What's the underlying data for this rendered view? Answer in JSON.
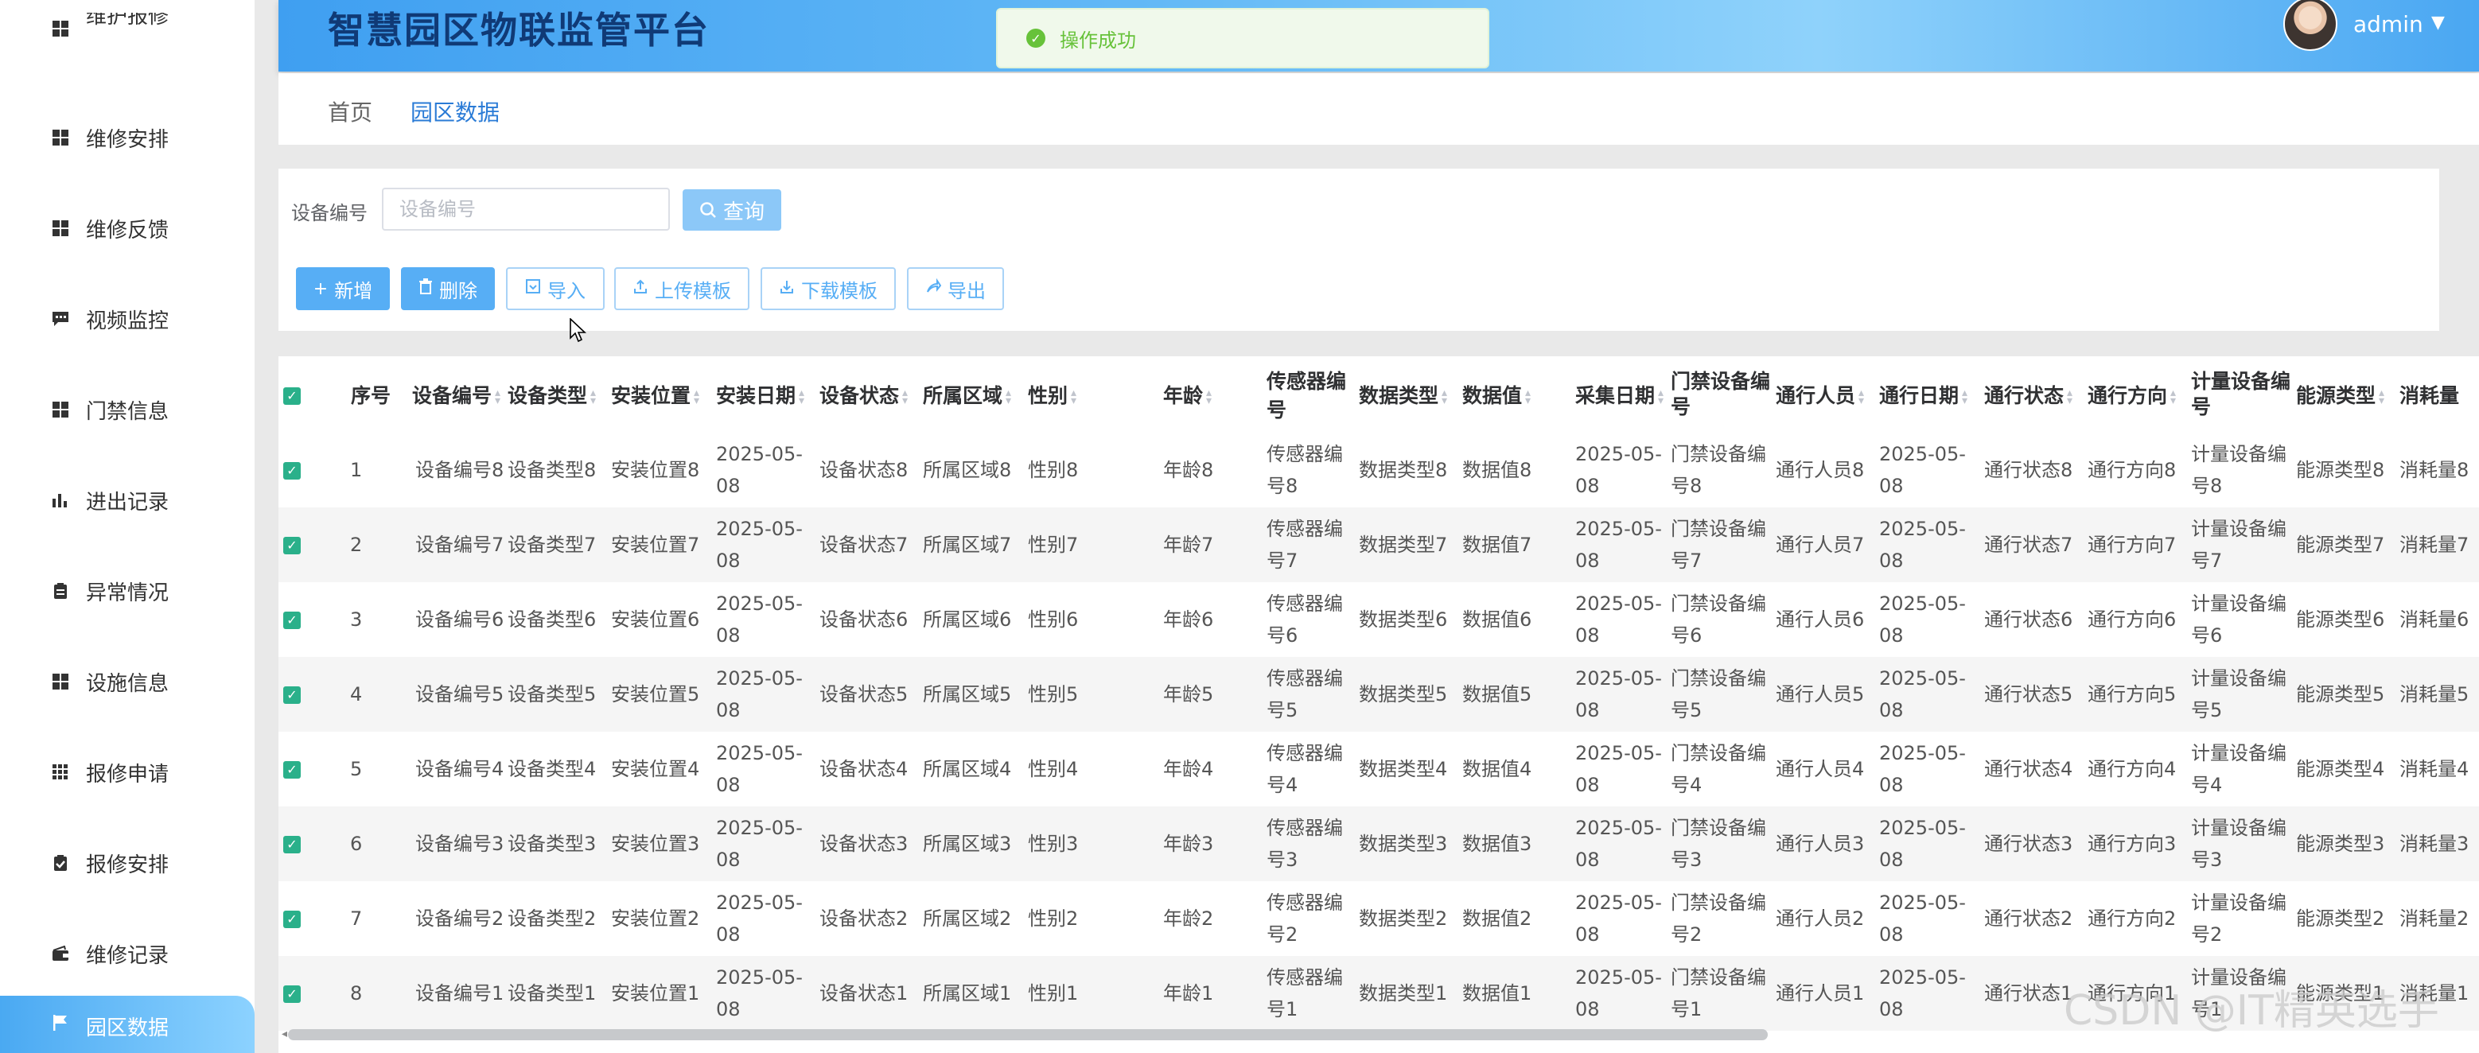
{
  "app": {
    "title": "智慧园区物联监管平台",
    "user": "admin"
  },
  "toast": {
    "message": "操作成功"
  },
  "sidebar": {
    "items": [
      {
        "label": "维护报修",
        "icon": "grid-icon"
      },
      {
        "label": "维修安排",
        "icon": "grid-icon"
      },
      {
        "label": "维修反馈",
        "icon": "grid-icon"
      },
      {
        "label": "视频监控",
        "icon": "chat-icon"
      },
      {
        "label": "门禁信息",
        "icon": "grid-icon"
      },
      {
        "label": "进出记录",
        "icon": "bar-chart-icon"
      },
      {
        "label": "异常情况",
        "icon": "clipboard-icon"
      },
      {
        "label": "设施信息",
        "icon": "grid-icon"
      },
      {
        "label": "报修申请",
        "icon": "apps-icon"
      },
      {
        "label": "报修安排",
        "icon": "clipboard-check-icon"
      },
      {
        "label": "维修记录",
        "icon": "wallet-icon"
      },
      {
        "label": "园区数据",
        "icon": "flag-icon",
        "active": true
      }
    ]
  },
  "breadcrumb": {
    "home": "首页",
    "current": "园区数据"
  },
  "search": {
    "label": "设备编号",
    "placeholder": "设备编号",
    "value": "",
    "query_label": "查询"
  },
  "toolbar": {
    "add": "新增",
    "delete": "删除",
    "import": "导入",
    "upload_template": "上传模板",
    "download_template": "下载模板",
    "export": "导出"
  },
  "table": {
    "columns": [
      "序号",
      "设备编号",
      "设备类型",
      "安装位置",
      "安装日期",
      "设备状态",
      "所属区域",
      "性别",
      "年龄",
      "传感器编号",
      "数据类型",
      "数据值",
      "采集日期",
      "门禁设备编号",
      "通行人员",
      "通行日期",
      "通行状态",
      "通行方向",
      "计量设备编号",
      "能源类型",
      "消耗量"
    ],
    "rows": [
      {
        "seq": "1",
        "c": [
          "设备编号8",
          "设备类型8",
          "安装位置8",
          "2025-05-08",
          "设备状态8",
          "所属区域8",
          "性别8",
          "年龄8",
          "传感器编号8",
          "数据类型8",
          "数据值8",
          "2025-05-08",
          "门禁设备编号8",
          "通行人员8",
          "2025-05-08",
          "通行状态8",
          "通行方向8",
          "计量设备编号8",
          "能源类型8",
          "消耗量8"
        ]
      },
      {
        "seq": "2",
        "c": [
          "设备编号7",
          "设备类型7",
          "安装位置7",
          "2025-05-08",
          "设备状态7",
          "所属区域7",
          "性别7",
          "年龄7",
          "传感器编号7",
          "数据类型7",
          "数据值7",
          "2025-05-08",
          "门禁设备编号7",
          "通行人员7",
          "2025-05-08",
          "通行状态7",
          "通行方向7",
          "计量设备编号7",
          "能源类型7",
          "消耗量7"
        ]
      },
      {
        "seq": "3",
        "c": [
          "设备编号6",
          "设备类型6",
          "安装位置6",
          "2025-05-08",
          "设备状态6",
          "所属区域6",
          "性别6",
          "年龄6",
          "传感器编号6",
          "数据类型6",
          "数据值6",
          "2025-05-08",
          "门禁设备编号6",
          "通行人员6",
          "2025-05-08",
          "通行状态6",
          "通行方向6",
          "计量设备编号6",
          "能源类型6",
          "消耗量6"
        ]
      },
      {
        "seq": "4",
        "c": [
          "设备编号5",
          "设备类型5",
          "安装位置5",
          "2025-05-08",
          "设备状态5",
          "所属区域5",
          "性别5",
          "年龄5",
          "传感器编号5",
          "数据类型5",
          "数据值5",
          "2025-05-08",
          "门禁设备编号5",
          "通行人员5",
          "2025-05-08",
          "通行状态5",
          "通行方向5",
          "计量设备编号5",
          "能源类型5",
          "消耗量5"
        ]
      },
      {
        "seq": "5",
        "c": [
          "设备编号4",
          "设备类型4",
          "安装位置4",
          "2025-05-08",
          "设备状态4",
          "所属区域4",
          "性别4",
          "年龄4",
          "传感器编号4",
          "数据类型4",
          "数据值4",
          "2025-05-08",
          "门禁设备编号4",
          "通行人员4",
          "2025-05-08",
          "通行状态4",
          "通行方向4",
          "计量设备编号4",
          "能源类型4",
          "消耗量4"
        ]
      },
      {
        "seq": "6",
        "c": [
          "设备编号3",
          "设备类型3",
          "安装位置3",
          "2025-05-08",
          "设备状态3",
          "所属区域3",
          "性别3",
          "年龄3",
          "传感器编号3",
          "数据类型3",
          "数据值3",
          "2025-05-08",
          "门禁设备编号3",
          "通行人员3",
          "2025-05-08",
          "通行状态3",
          "通行方向3",
          "计量设备编号3",
          "能源类型3",
          "消耗量3"
        ]
      },
      {
        "seq": "7",
        "c": [
          "设备编号2",
          "设备类型2",
          "安装位置2",
          "2025-05-08",
          "设备状态2",
          "所属区域2",
          "性别2",
          "年龄2",
          "传感器编号2",
          "数据类型2",
          "数据值2",
          "2025-05-08",
          "门禁设备编号2",
          "通行人员2",
          "2025-05-08",
          "通行状态2",
          "通行方向2",
          "计量设备编号2",
          "能源类型2",
          "消耗量2"
        ]
      },
      {
        "seq": "8",
        "c": [
          "设备编号1",
          "设备类型1",
          "安装位置1",
          "2025-05-08",
          "设备状态1",
          "所属区域1",
          "性别1",
          "年龄1",
          "传感器编号1",
          "数据类型1",
          "数据值1",
          "2025-05-08",
          "门禁设备编号1",
          "通行人员1",
          "2025-05-08",
          "通行状态1",
          "通行方向1",
          "计量设备编号1",
          "能源类型1",
          "消耗量1"
        ]
      }
    ]
  },
  "watermark": "CSDN @IT精英选手",
  "colors": {
    "primary": "#57aef5",
    "success": "#67c23a",
    "checkbox": "#2ab08a",
    "title": "#103a76"
  }
}
